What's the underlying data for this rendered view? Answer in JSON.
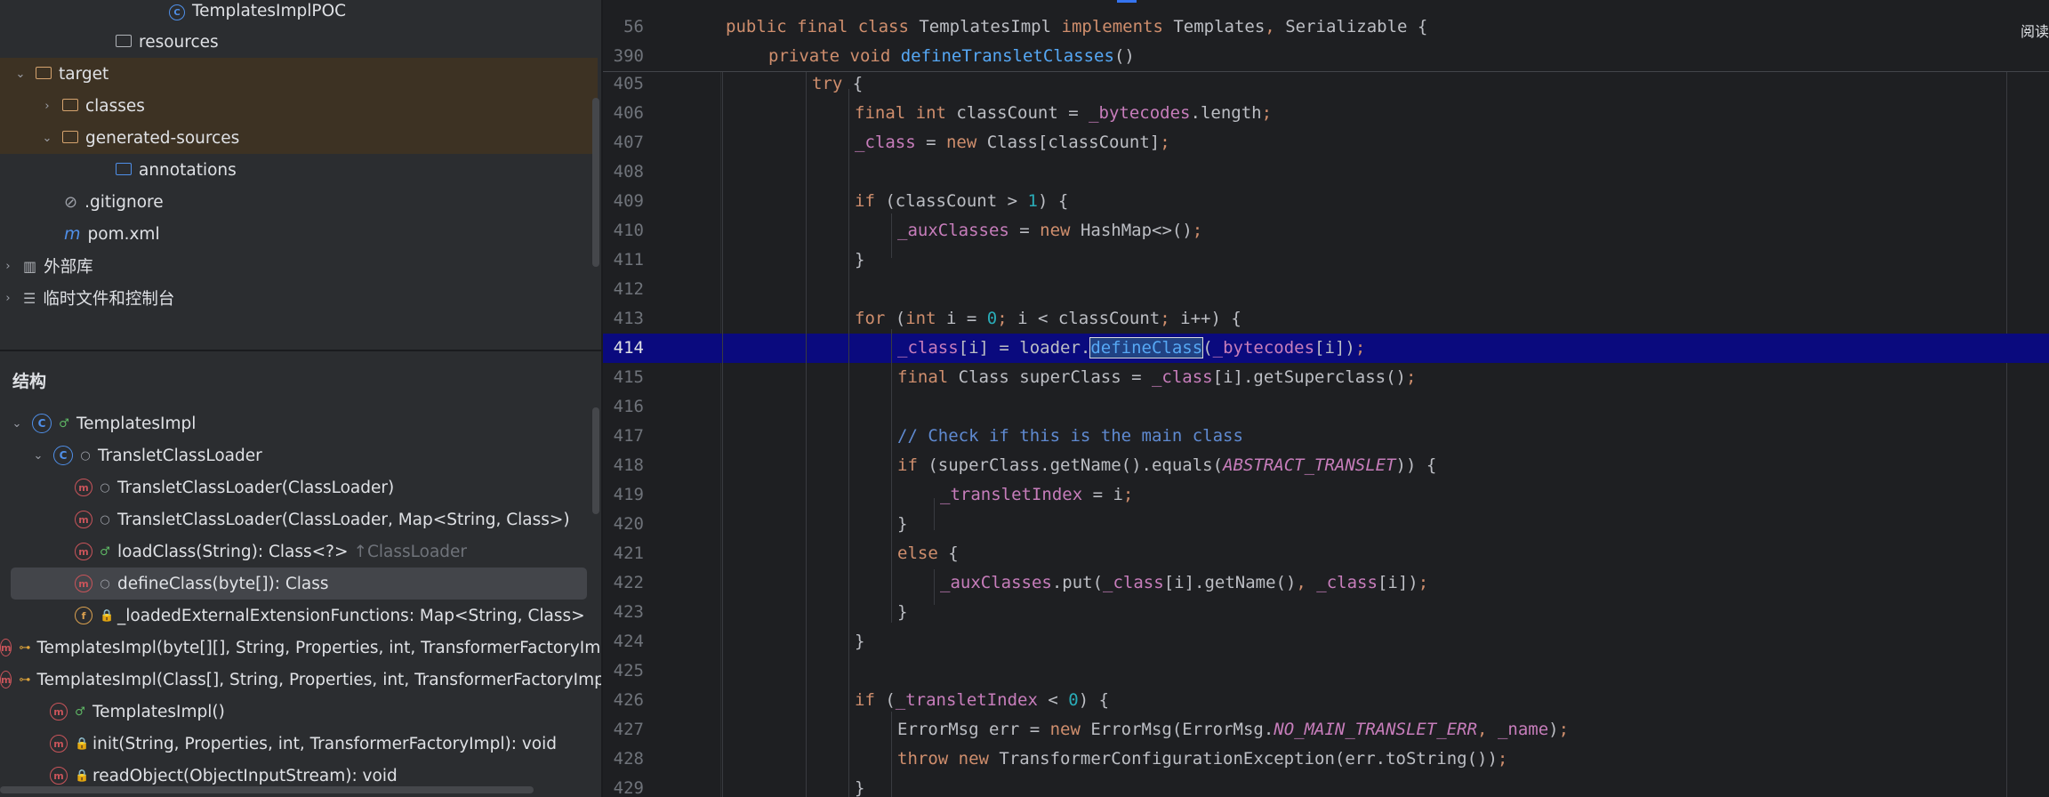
{
  "project_tree": {
    "items": [
      {
        "label": "TemplatesImplPOC",
        "icon": "class-icon",
        "arrow": ""
      },
      {
        "label": "resources",
        "icon": "resources-folder-icon",
        "arrow": ""
      },
      {
        "label": "target",
        "icon": "folder-icon",
        "arrow": "⌄"
      },
      {
        "label": "classes",
        "icon": "folder-icon",
        "arrow": "›"
      },
      {
        "label": "generated-sources",
        "icon": "folder-icon",
        "arrow": "⌄"
      },
      {
        "label": "annotations",
        "icon": "source-folder-icon",
        "arrow": ""
      },
      {
        "label": ".gitignore",
        "icon": "ignore-file-icon",
        "arrow": ""
      },
      {
        "label": "pom.xml",
        "icon": "maven-icon",
        "arrow": ""
      },
      {
        "label": "外部库",
        "icon": "library-icon",
        "arrow": "›"
      },
      {
        "label": "临时文件和控制台",
        "icon": "scratches-icon",
        "arrow": "›"
      }
    ]
  },
  "structure": {
    "title": "结构",
    "items": [
      {
        "label": "TemplatesImpl",
        "suffix": ""
      },
      {
        "label": "TransletClassLoader",
        "suffix": ""
      },
      {
        "label": "TransletClassLoader(ClassLoader)",
        "suffix": ""
      },
      {
        "label": "TransletClassLoader(ClassLoader, Map<String, Class>)",
        "suffix": ""
      },
      {
        "label": "loadClass(String): Class<?>",
        "suffix": "↑ClassLoader"
      },
      {
        "label": "defineClass(byte[]): Class",
        "suffix": ""
      },
      {
        "label": "_loadedExternalExtensionFunctions: Map<String, Class>",
        "suffix": ""
      },
      {
        "label": "TemplatesImpl(byte[][], String, Properties, int, TransformerFactoryImpl)",
        "suffix": ""
      },
      {
        "label": "TemplatesImpl(Class[], String, Properties, int, TransformerFactoryImpl)",
        "suffix": ""
      },
      {
        "label": "TemplatesImpl()",
        "suffix": ""
      },
      {
        "label": "init(String, Properties, int, TransformerFactoryImpl): void",
        "suffix": ""
      },
      {
        "label": "readObject(ObjectInputStream): void",
        "suffix": ""
      }
    ]
  },
  "editor": {
    "reader_mode": "阅读",
    "sticky": [
      {
        "num": "56",
        "tokens": [
          [
            "kw",
            "public final class "
          ],
          [
            "",
            "TemplatesImpl "
          ],
          [
            "kw",
            "implements "
          ],
          [
            "",
            "Templates"
          ],
          [
            "kw",
            ", "
          ],
          [
            "",
            "Serializable {"
          ]
        ]
      },
      {
        "num": "390",
        "tokens": [
          [
            "kw",
            "private void "
          ],
          [
            "fn",
            "defineTransletClasses"
          ],
          [
            "",
            "()"
          ]
        ]
      }
    ],
    "lines": [
      {
        "num": "405",
        "tokens": [
          [
            "kw",
            "try "
          ],
          [
            "",
            "{"
          ]
        ]
      },
      {
        "num": "406",
        "tokens": [
          [
            "kw",
            "final int "
          ],
          [
            "",
            "classCount = "
          ],
          [
            "fld",
            "_bytecodes"
          ],
          [
            "",
            ".length"
          ],
          [
            "kw",
            ";"
          ]
        ]
      },
      {
        "num": "407",
        "tokens": [
          [
            "fld",
            "_class"
          ],
          [
            "",
            " = "
          ],
          [
            "kw",
            "new "
          ],
          [
            "",
            "Class[classCount]"
          ],
          [
            "kw",
            ";"
          ]
        ]
      },
      {
        "num": "408",
        "tokens": []
      },
      {
        "num": "409",
        "tokens": [
          [
            "kw",
            "if "
          ],
          [
            "",
            "(classCount > "
          ],
          [
            "num",
            "1"
          ],
          [
            "",
            ") {"
          ]
        ]
      },
      {
        "num": "410",
        "tokens": [
          [
            "fld",
            "_auxClasses"
          ],
          [
            "",
            " = "
          ],
          [
            "kw",
            "new "
          ],
          [
            "",
            "HashMap<>()"
          ],
          [
            "kw",
            ";"
          ]
        ]
      },
      {
        "num": "411",
        "tokens": [
          [
            "",
            "}"
          ]
        ]
      },
      {
        "num": "412",
        "tokens": []
      },
      {
        "num": "413",
        "tokens": [
          [
            "kw",
            "for "
          ],
          [
            "",
            "("
          ],
          [
            "kw",
            "int "
          ],
          [
            "",
            "i = "
          ],
          [
            "num",
            "0"
          ],
          [
            "kw",
            "; "
          ],
          [
            "",
            "i < classCount"
          ],
          [
            "kw",
            "; "
          ],
          [
            "",
            "i++) {"
          ]
        ]
      },
      {
        "num": "414",
        "tokens": [
          [
            "fld",
            "_class"
          ],
          [
            "",
            "[i] = loader."
          ],
          [
            "sel",
            "defineClass"
          ],
          [
            "",
            "("
          ],
          [
            "fld",
            "_bytecodes"
          ],
          [
            "",
            "[i])"
          ],
          [
            "kw",
            ";"
          ]
        ]
      },
      {
        "num": "415",
        "tokens": [
          [
            "kw",
            "final "
          ],
          [
            "",
            "Class superClass = "
          ],
          [
            "fld",
            "_class"
          ],
          [
            "",
            "[i].getSuperclass()"
          ],
          [
            "kw",
            ";"
          ]
        ]
      },
      {
        "num": "416",
        "tokens": []
      },
      {
        "num": "417",
        "tokens": [
          [
            "cmt",
            "// Check if this is the main class"
          ]
        ]
      },
      {
        "num": "418",
        "tokens": [
          [
            "kw",
            "if "
          ],
          [
            "",
            "(superClass.getName().equals("
          ],
          [
            "const",
            "ABSTRACT_TRANSLET"
          ],
          [
            "",
            ")) {"
          ]
        ]
      },
      {
        "num": "419",
        "tokens": [
          [
            "fld",
            "_transletIndex"
          ],
          [
            "",
            " = i"
          ],
          [
            "kw",
            ";"
          ]
        ]
      },
      {
        "num": "420",
        "tokens": [
          [
            "",
            "}"
          ]
        ]
      },
      {
        "num": "421",
        "tokens": [
          [
            "kw",
            "else "
          ],
          [
            "",
            "{"
          ]
        ]
      },
      {
        "num": "422",
        "tokens": [
          [
            "fld",
            "_auxClasses"
          ],
          [
            "",
            ".put("
          ],
          [
            "fld",
            "_class"
          ],
          [
            "",
            "[i].getName()"
          ],
          [
            "kw",
            ", "
          ],
          [
            "fld",
            "_class"
          ],
          [
            "",
            "[i])"
          ],
          [
            "kw",
            ";"
          ]
        ]
      },
      {
        "num": "423",
        "tokens": [
          [
            "",
            "}"
          ]
        ]
      },
      {
        "num": "424",
        "tokens": [
          [
            "",
            "}"
          ]
        ]
      },
      {
        "num": "425",
        "tokens": []
      },
      {
        "num": "426",
        "tokens": [
          [
            "kw",
            "if "
          ],
          [
            "",
            "("
          ],
          [
            "fld",
            "_transletIndex"
          ],
          [
            "",
            " < "
          ],
          [
            "num",
            "0"
          ],
          [
            "",
            ") {"
          ]
        ]
      },
      {
        "num": "427",
        "tokens": [
          [
            "",
            "ErrorMsg err = "
          ],
          [
            "kw",
            "new "
          ],
          [
            "",
            "ErrorMsg(ErrorMsg."
          ],
          [
            "const",
            "NO_MAIN_TRANSLET_ERR"
          ],
          [
            "kw",
            ", "
          ],
          [
            "fld",
            "_name"
          ],
          [
            "",
            ")"
          ],
          [
            "kw",
            ";"
          ]
        ]
      },
      {
        "num": "428",
        "tokens": [
          [
            "kw",
            "throw new "
          ],
          [
            "",
            "TransformerConfigurationException(err.toString())"
          ],
          [
            "kw",
            ";"
          ]
        ]
      },
      {
        "num": "429",
        "tokens": [
          [
            "",
            "}"
          ]
        ]
      }
    ]
  }
}
